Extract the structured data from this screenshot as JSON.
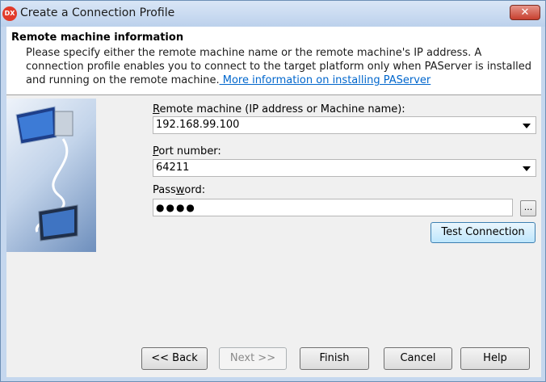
{
  "window": {
    "title": "Create a Connection Profile",
    "app_icon": "DX",
    "close_glyph": "✕"
  },
  "header": {
    "title": "Remote machine information",
    "description": "Please specify either the remote machine name or the remote machine's IP address. A connection profile enables you to connect to the target platform only when PAServer is installed and running on the remote machine.",
    "link": " More information on installing PAServer"
  },
  "form": {
    "remote_machine_label_access": "R",
    "remote_machine_label_rest": "emote machine (IP address or Machine name):",
    "remote_machine_value": "192.168.99.100",
    "port_label_access": "P",
    "port_label_rest": "ort number:",
    "port_value": "64211",
    "password_label_pre": "Pass",
    "password_label_access": "w",
    "password_label_rest": "ord:",
    "password_masked": "●●●●",
    "browse_label": "..."
  },
  "buttons": {
    "test_connection": "Test Connection",
    "back": "<< Back",
    "next": "Next >>",
    "finish": "Finish",
    "cancel": "Cancel",
    "help": "Help"
  }
}
